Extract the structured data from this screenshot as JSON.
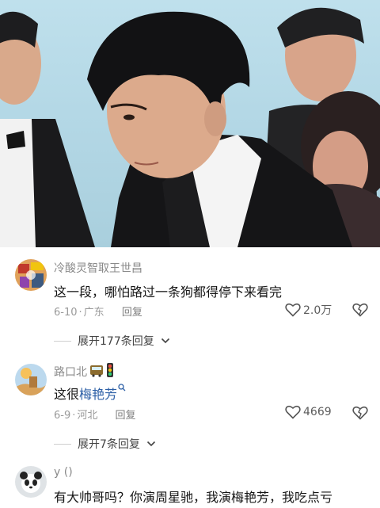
{
  "video": {
    "description_icon": "video-frame"
  },
  "comments": [
    {
      "username": "冷酸灵智取王世昌",
      "text": "这一段，哪怕路过一条狗都得停下来看完",
      "date": "6-10",
      "location": "广东",
      "reply_label": "回复",
      "likes": "2.0万",
      "expand_label": "展开177条回复"
    },
    {
      "username": "路口北",
      "text_prefix": "这很",
      "keyword": "梅艳芳",
      "date": "6-9",
      "location": "河北",
      "reply_label": "回复",
      "likes": "4669",
      "expand_label": "展开7条回复"
    },
    {
      "username": "y ()",
      "text": "有大帅哥吗？你演周星驰，我演梅艳芳，我吃点亏"
    }
  ],
  "icons": {
    "heart": "heart-icon",
    "dislike": "broken-heart-icon",
    "chevron": "chevron-down-icon",
    "search": "search-icon",
    "emoji_bus": "bus-emoji-icon",
    "emoji_traffic_light": "traffic-light-emoji-icon"
  },
  "colors": {
    "username": "#8a8a8a",
    "keyword": "#2c5fa6",
    "meta": "#9a9a9a"
  }
}
